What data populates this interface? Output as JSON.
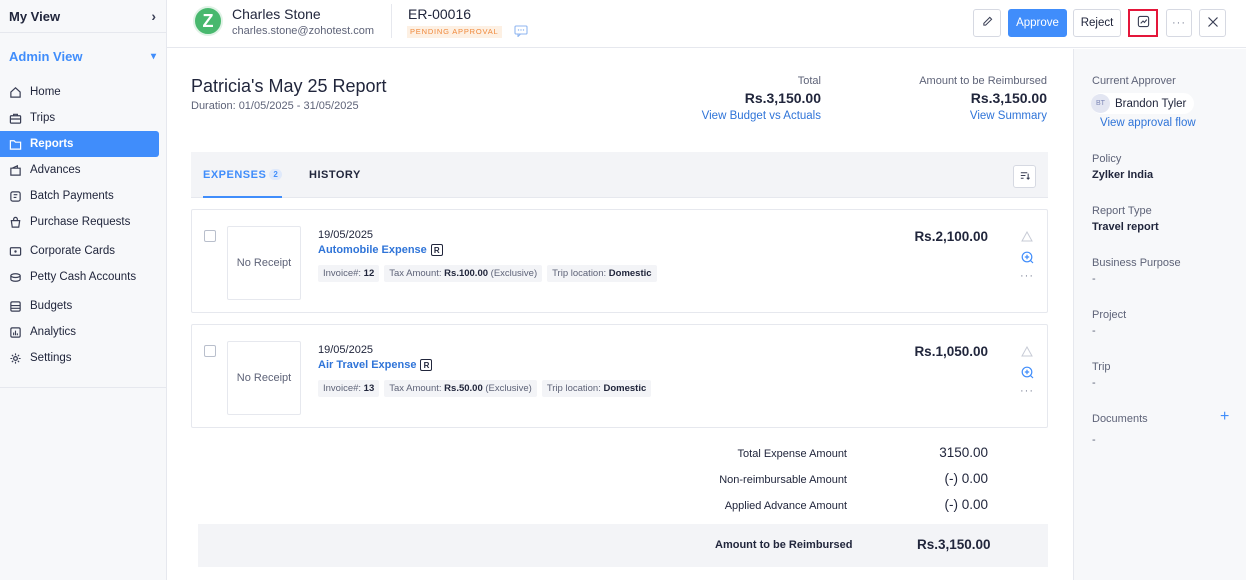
{
  "sidebar": {
    "my_view": "My View",
    "admin_view": "Admin View",
    "items": [
      {
        "label": "Home",
        "icon": "home-icon"
      },
      {
        "label": "Trips",
        "icon": "suitcase-icon"
      },
      {
        "label": "Reports",
        "icon": "folder-icon",
        "active": true
      },
      {
        "label": "Advances",
        "icon": "wallet-icon"
      },
      {
        "label": "Batch Payments",
        "icon": "batch-payments-icon"
      },
      {
        "label": "Purchase Requests",
        "icon": "shopping-bag-icon"
      },
      {
        "label": "Corporate Cards",
        "icon": "card-icon"
      },
      {
        "label": "Petty Cash Accounts",
        "icon": "petty-cash-icon"
      },
      {
        "label": "Budgets",
        "icon": "budget-icon"
      },
      {
        "label": "Analytics",
        "icon": "analytics-icon"
      },
      {
        "label": "Settings",
        "icon": "gear-icon"
      }
    ]
  },
  "header": {
    "avatar_letter": "Z",
    "user_name": "Charles Stone",
    "user_email": "charles.stone@zohotest.com",
    "report_number": "ER-00016",
    "status": "PENDING APPROVAL",
    "approve_label": "Approve",
    "reject_label": "Reject",
    "more_label": "···",
    "accent_color": "#408dfb",
    "highlight_color": "#e4163a"
  },
  "report": {
    "title": "Patricia's May 25 Report",
    "duration": "Duration: 01/05/2025 - 31/05/2025",
    "total_label": "Total",
    "total_value": "Rs.3,150.00",
    "budget_link": "View Budget vs Actuals",
    "reimb_label": "Amount to be Reimbursed",
    "reimb_value": "Rs.3,150.00",
    "summary_link": "View Summary"
  },
  "tabs": {
    "expenses_label": "EXPENSES",
    "expenses_count": "2",
    "history_label": "HISTORY"
  },
  "expenses": [
    {
      "receipt": "No Receipt",
      "date": "19/05/2025",
      "category": "Automobile Expense",
      "badge": "R",
      "invoice_label": "Invoice#:",
      "invoice": "12",
      "tax_label": "Tax Amount:",
      "tax": "Rs.100.00",
      "tax_type": "(Exclusive)",
      "trip_label": "Trip location:",
      "trip": "Domestic",
      "amount": "Rs.2,100.00"
    },
    {
      "receipt": "No Receipt",
      "date": "19/05/2025",
      "category": "Air Travel Expense",
      "badge": "R",
      "invoice_label": "Invoice#:",
      "invoice": "13",
      "tax_label": "Tax Amount:",
      "tax": "Rs.50.00",
      "tax_type": "(Exclusive)",
      "trip_label": "Trip location:",
      "trip": "Domestic",
      "amount": "Rs.1,050.00"
    }
  ],
  "summary": {
    "rows": [
      {
        "label": "Total Expense Amount",
        "value": "3150.00"
      },
      {
        "label": "Non-reimbursable Amount",
        "value": "(-) 0.00"
      },
      {
        "label": "Applied Advance Amount",
        "value": "(-) 0.00"
      }
    ],
    "reimb_label": "Amount to be Reimbursed",
    "reimb_value": "Rs.3,150.00"
  },
  "right_panel": {
    "current_approver_label": "Current Approver",
    "approver_initials": "BT",
    "approver_name": "Brandon Tyler",
    "approval_flow_link": "View approval flow",
    "policy_label": "Policy",
    "policy_value": "Zylker India",
    "report_type_label": "Report Type",
    "report_type_value": "Travel report",
    "business_purpose_label": "Business Purpose",
    "business_purpose_value": "-",
    "project_label": "Project",
    "project_value": "-",
    "trip_label": "Trip",
    "trip_value": "-",
    "documents_label": "Documents",
    "documents_value": "-",
    "add_label": "+"
  }
}
